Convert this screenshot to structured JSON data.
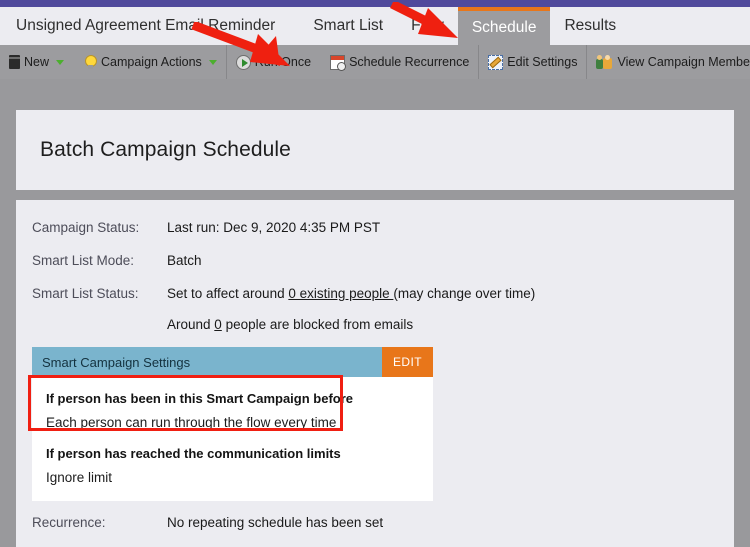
{
  "theme": {
    "top_bar_color": "#504a9c",
    "frame_gray": "#99999c",
    "panel_bg": "#ececf1",
    "toolbar_gray": "#9c9c9f",
    "accent_orange": "#e8761a",
    "settings_header_blue": "#7ab4cd",
    "highlight_red": "#f01f12"
  },
  "tabs": [
    {
      "label": "Unsigned Agreement Email Reminder",
      "active": false,
      "name": "tab-campaign-name"
    },
    {
      "label": "Smart List",
      "active": false,
      "name": "tab-smart-list"
    },
    {
      "label": "Flow",
      "active": false,
      "name": "tab-flow"
    },
    {
      "label": "Schedule",
      "active": true,
      "name": "tab-schedule"
    },
    {
      "label": "Results",
      "active": false,
      "name": "tab-results"
    }
  ],
  "toolbar": {
    "new_label": "New",
    "new_icon": "document-icon",
    "campaign_actions_label": "Campaign Actions",
    "campaign_actions_icon": "lightbulb-icon",
    "run_once_label": "Run Once",
    "run_once_icon": "play-circle-icon",
    "schedule_recurrence_label": "Schedule Recurrence",
    "schedule_recurrence_icon": "calendar-clock-icon",
    "edit_settings_label": "Edit Settings",
    "edit_settings_icon": "pencil-icon",
    "view_campaign_members_label": "View Campaign Members",
    "view_campaign_members_icon": "people-icon",
    "dropdown_icon": "caret-down-icon"
  },
  "page": {
    "title": "Batch Campaign Schedule"
  },
  "fields": {
    "campaign_status_label": "Campaign Status:",
    "campaign_status_value": "Last run: Dec 9, 2020 4:35 PM PST",
    "smart_list_mode_label": "Smart List Mode:",
    "smart_list_mode_value": "Batch",
    "smart_list_status_label": "Smart List Status:",
    "smart_list_status_prefix": "Set to affect around ",
    "smart_list_status_link": "0 existing people ",
    "smart_list_status_suffix": "(may change over time)",
    "blocked_prefix": "Around ",
    "blocked_count": "0",
    "blocked_suffix": " people are blocked from emails",
    "recurrence_label": "Recurrence:",
    "recurrence_value": "No repeating schedule has been set"
  },
  "settings_card": {
    "header_title": "Smart Campaign Settings",
    "edit_label": "EDIT",
    "groups": [
      {
        "heading": "If person has been in this Smart Campaign before",
        "value": "Each person can run through the flow every time",
        "highlighted": true
      },
      {
        "heading": "If person has reached the communication limits",
        "value": "Ignore limit",
        "highlighted": false
      }
    ]
  },
  "annotations": {
    "arrow_1_target": "schedule-recurrence-toolbar-button",
    "arrow_2_target": "tab-schedule",
    "highlight_target": "smart-campaign-before-setting"
  }
}
